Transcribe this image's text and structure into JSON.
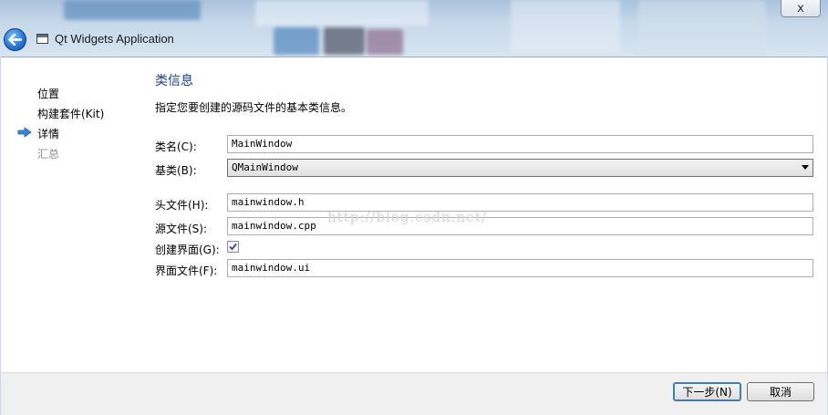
{
  "window": {
    "title": "Qt Widgets Application",
    "close_label": "x"
  },
  "sidebar": {
    "items": [
      {
        "label": "位置",
        "state": "done"
      },
      {
        "label": "构建套件(Kit)",
        "state": "done"
      },
      {
        "label": "详情",
        "state": "current"
      },
      {
        "label": "汇总",
        "state": "pending"
      }
    ]
  },
  "page": {
    "title": "类信息",
    "description": "指定您要创建的源码文件的基本类信息。"
  },
  "form": {
    "class_name": {
      "label": "类名(C):",
      "value": "MainWindow"
    },
    "base_class": {
      "label": "基类(B):",
      "value": "QMainWindow"
    },
    "header_file": {
      "label": "头文件(H):",
      "value": "mainwindow.h"
    },
    "source_file": {
      "label": "源文件(S):",
      "value": "mainwindow.cpp"
    },
    "generate_form": {
      "label": "创建界面(G):",
      "checked": true,
      "check_glyph": "✓"
    },
    "form_file": {
      "label": "界面文件(F):",
      "value": "mainwindow.ui"
    }
  },
  "watermark": "http://blog.csdn.net/",
  "footer": {
    "next_label": "下一步(N)",
    "cancel_label": "取消"
  },
  "colors": {
    "title_accent": "#1f3f84",
    "arrow": "#3a86d6"
  }
}
